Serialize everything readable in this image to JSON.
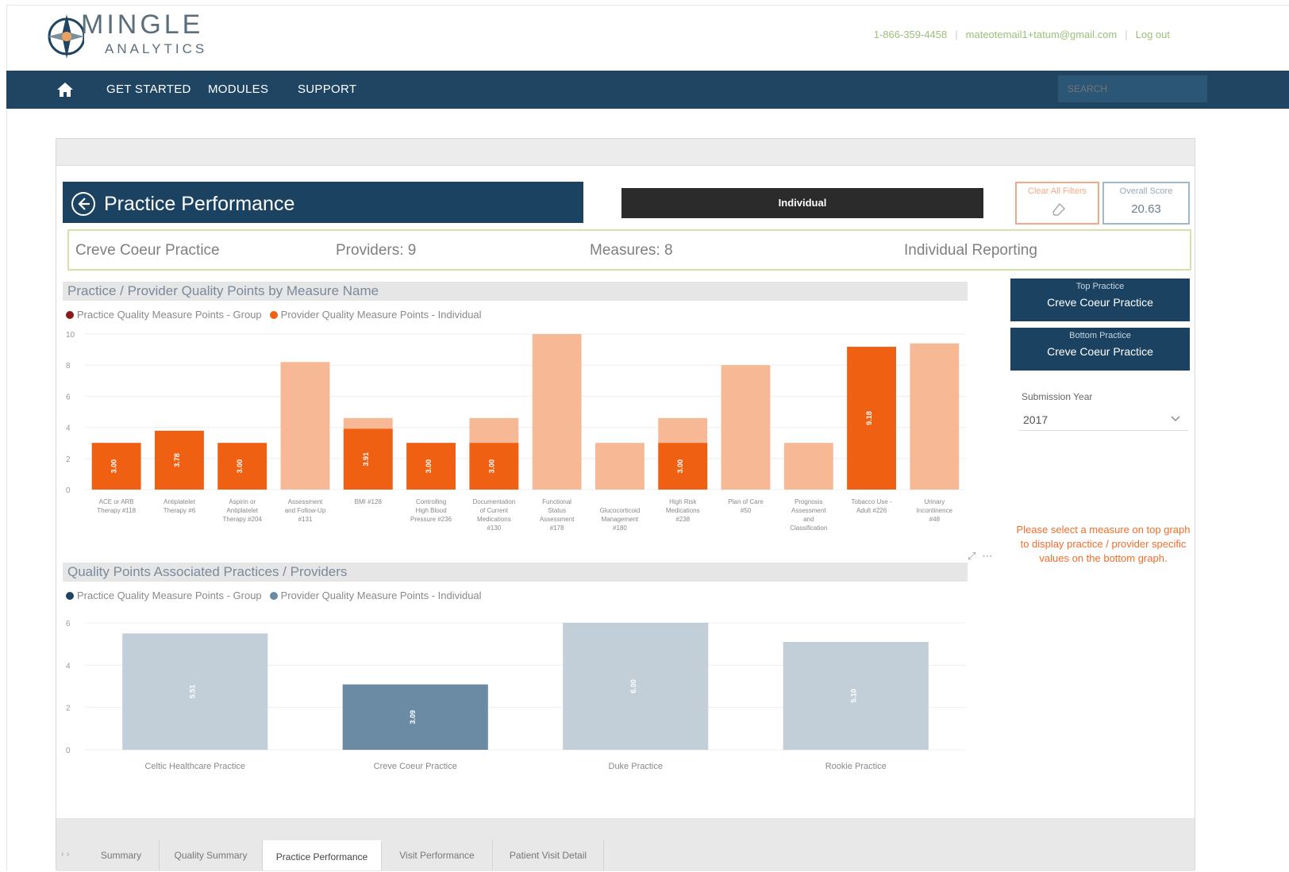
{
  "header": {
    "logo_word1": "MINGLE",
    "logo_word2": "ANALYTICS",
    "phone": "1-866-359-4458",
    "email": "mateotemail1+tatum@gmail.com",
    "logout": "Log out"
  },
  "nav": {
    "items": [
      "GET STARTED",
      "MODULES",
      "SUPPORT"
    ],
    "search_placeholder": "SEARCH"
  },
  "report": {
    "title": "Practice Performance",
    "mode_button": "Individual",
    "clear_filters": "Clear All Filters",
    "overall_score_label": "Overall Score",
    "overall_score_value": "20.63",
    "info": {
      "practice": "Creve Coeur Practice",
      "providers": "Providers: 9",
      "measures": "Measures: 8",
      "reporting": "Individual Reporting"
    },
    "top_practice_label": "Top Practice",
    "top_practice_value": "Creve Coeur Practice",
    "bottom_practice_label": "Bottom Practice",
    "bottom_practice_value": "Creve Coeur Practice",
    "submission_year_label": "Submission Year",
    "submission_year_value": "2017",
    "hint": "Please select a measure on top graph to display practice / provider specific values on the bottom graph."
  },
  "chart_data": [
    {
      "type": "bar",
      "title": "Practice / Provider Quality Points by Measure Name",
      "legend": [
        "Practice Quality Measure Points - Group",
        "Provider Quality Measure Points - Individual"
      ],
      "colors": {
        "group": "#f7b896",
        "individual": "#f06013",
        "legend_group": "#8b1a1a",
        "legend_individual": "#f06013"
      },
      "ylim": [
        0,
        10
      ],
      "yticks": [
        0,
        2,
        4,
        6,
        8,
        10
      ],
      "categories": [
        "ACE or ARB Therapy #118",
        "Antiplatelet Therapy #6",
        "Aspirin or Antiplatelet Therapy #204",
        "Assessment and Follow-Up #131",
        "BMI #128",
        "Controlling High Blood Pressure #236",
        "Documentation of Current Medications #130",
        "Functional Status Assessment #178",
        "Glucocorticoid Management #180",
        "High Risk Medications #238",
        "Plan of Care #50",
        "Prognosis Assessment and Classification #179",
        "Tobacco Use - Adult #226",
        "Urinary Incontinence #48"
      ],
      "series": [
        {
          "name": "Practice Quality Measure Points - Group",
          "values": [
            3.0,
            3.78,
            3.0,
            8.2,
            4.6,
            3.0,
            4.6,
            10.0,
            3.0,
            4.6,
            8.0,
            3.0,
            9.18,
            9.4
          ]
        },
        {
          "name": "Provider Quality Measure Points - Individual",
          "values": [
            3.0,
            3.78,
            3.0,
            null,
            3.91,
            3.0,
            3.0,
            null,
            null,
            3.0,
            null,
            null,
            9.18,
            null
          ]
        }
      ],
      "data_labels": [
        "3.00",
        "3.78",
        "3.00",
        "",
        "3.91",
        "3.00",
        "3.00",
        "",
        "",
        "3.00",
        "",
        "",
        "9.18",
        ""
      ]
    },
    {
      "type": "bar",
      "title": "Quality Points Associated Practices / Providers",
      "legend": [
        "Practice Quality Measure Points - Group",
        "Provider Quality Measure Points - Individual"
      ],
      "colors": {
        "other": "#c2cfd9",
        "selected": "#6a8ba3",
        "legend_group": "#1f4563",
        "legend_individual": "#6a8ba3"
      },
      "ylim": [
        0,
        6
      ],
      "yticks": [
        0,
        2,
        4,
        6
      ],
      "categories": [
        "Celtic Healthcare Practice",
        "Creve Coeur Practice",
        "Duke Practice",
        "Rookie Practice"
      ],
      "values": [
        5.5,
        3.09,
        6.0,
        5.1
      ],
      "data_labels": [
        "5.51",
        "3.09",
        "6.00",
        "5.10"
      ],
      "highlighted": "Creve Coeur Practice"
    }
  ],
  "tabs": [
    "Summary",
    "Quality Summary",
    "Practice Performance",
    "Visit Performance",
    "Patient Visit Detail"
  ],
  "active_tab": "Practice Performance"
}
